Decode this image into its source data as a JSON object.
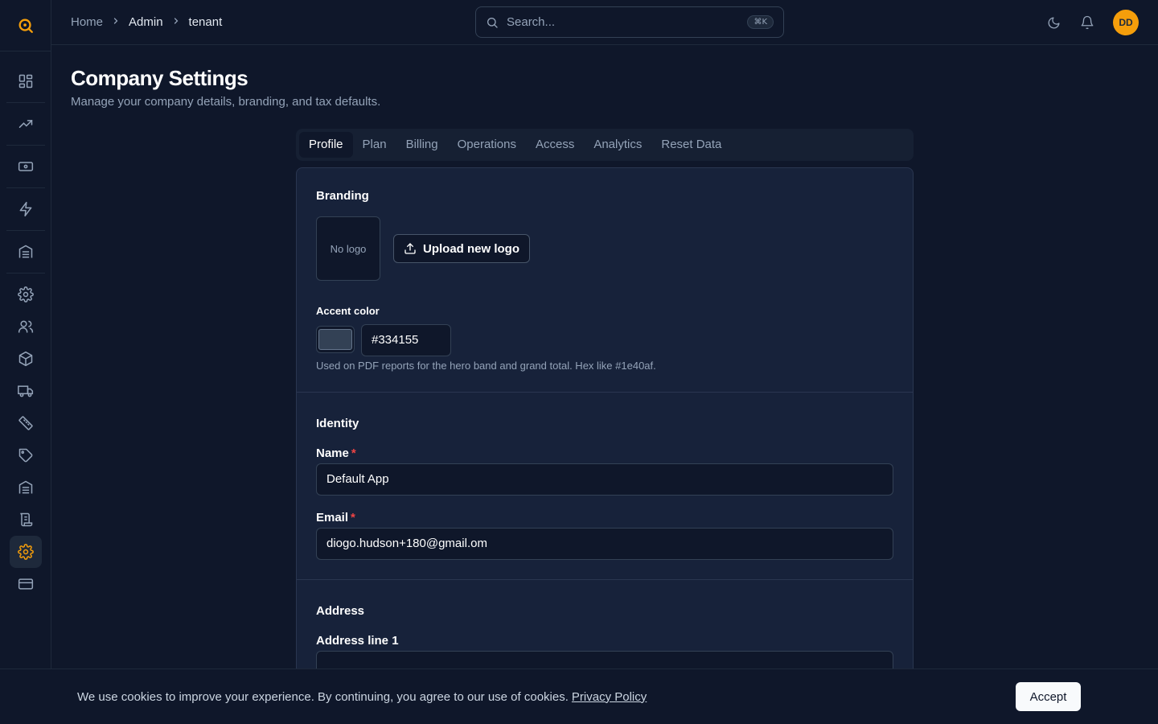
{
  "header": {
    "breadcrumb": [
      "Home",
      "Admin",
      "tenant"
    ],
    "search_placeholder": "Search...",
    "search_shortcut": "⌘K",
    "avatar_initials": "DD"
  },
  "page": {
    "title": "Company Settings",
    "subtitle": "Manage your company details, branding, and tax defaults."
  },
  "tabs": [
    {
      "label": "Profile",
      "active": true
    },
    {
      "label": "Plan",
      "active": false
    },
    {
      "label": "Billing",
      "active": false
    },
    {
      "label": "Operations",
      "active": false
    },
    {
      "label": "Access",
      "active": false
    },
    {
      "label": "Analytics",
      "active": false
    },
    {
      "label": "Reset Data",
      "active": false
    }
  ],
  "branding": {
    "title": "Branding",
    "no_logo": "No logo",
    "upload_label": "Upload new logo",
    "accent_label": "Accent color",
    "accent_value": "#334155",
    "accent_hint": "Used on PDF reports for the hero band and grand total. Hex like #1e40af."
  },
  "identity": {
    "title": "Identity",
    "name_label": "Name",
    "name_value": "Default App",
    "email_label": "Email",
    "email_value": "diogo.hudson+180@gmail.om",
    "required_mark": "*"
  },
  "address": {
    "title": "Address",
    "line1_label": "Address line 1",
    "line1_value": ""
  },
  "cookie": {
    "text": "We use cookies to improve your experience. By continuing, you agree to our use of cookies.",
    "link": "Privacy Policy",
    "accept": "Accept"
  },
  "colors": {
    "accent": "#f59e0b",
    "background": "#0f172a",
    "card": "#17223a"
  }
}
